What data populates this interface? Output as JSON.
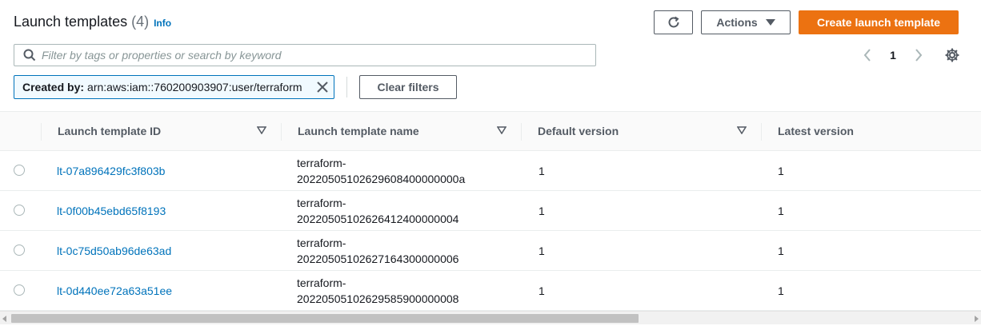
{
  "header": {
    "title": "Launch templates",
    "count": "(4)",
    "info_label": "Info"
  },
  "toolbar": {
    "refresh_icon": "refresh-icon",
    "actions_label": "Actions",
    "create_label": "Create launch template",
    "create_color": "#ec7211"
  },
  "search": {
    "placeholder": "Filter by tags or properties or search by keyword",
    "value": ""
  },
  "pagination": {
    "current_page": "1"
  },
  "filter_token": {
    "label": "Created by:",
    "value": "arn:aws:iam::760200903907:user/terraform"
  },
  "clear_filters_label": "Clear filters",
  "table": {
    "columns": [
      "Launch template ID",
      "Launch template name",
      "Default version",
      "Latest version"
    ],
    "rows": [
      {
        "id": "lt-07a896429fc3f803b",
        "name_line1": "terraform-",
        "name_line2": "20220505102629608400000000a",
        "default_version": "1",
        "latest_version": "1"
      },
      {
        "id": "lt-0f00b45ebd65f8193",
        "name_line1": "terraform-",
        "name_line2": "20220505102626412400000004",
        "default_version": "1",
        "latest_version": "1"
      },
      {
        "id": "lt-0c75d50ab96de63ad",
        "name_line1": "terraform-",
        "name_line2": "20220505102627164300000006",
        "default_version": "1",
        "latest_version": "1"
      },
      {
        "id": "lt-0d440ee72a63a51ee",
        "name_line1": "terraform-",
        "name_line2": "20220505102629585900000008",
        "default_version": "1",
        "latest_version": "1"
      }
    ]
  },
  "colors": {
    "link": "#0073bb",
    "primary": "#ec7211"
  }
}
